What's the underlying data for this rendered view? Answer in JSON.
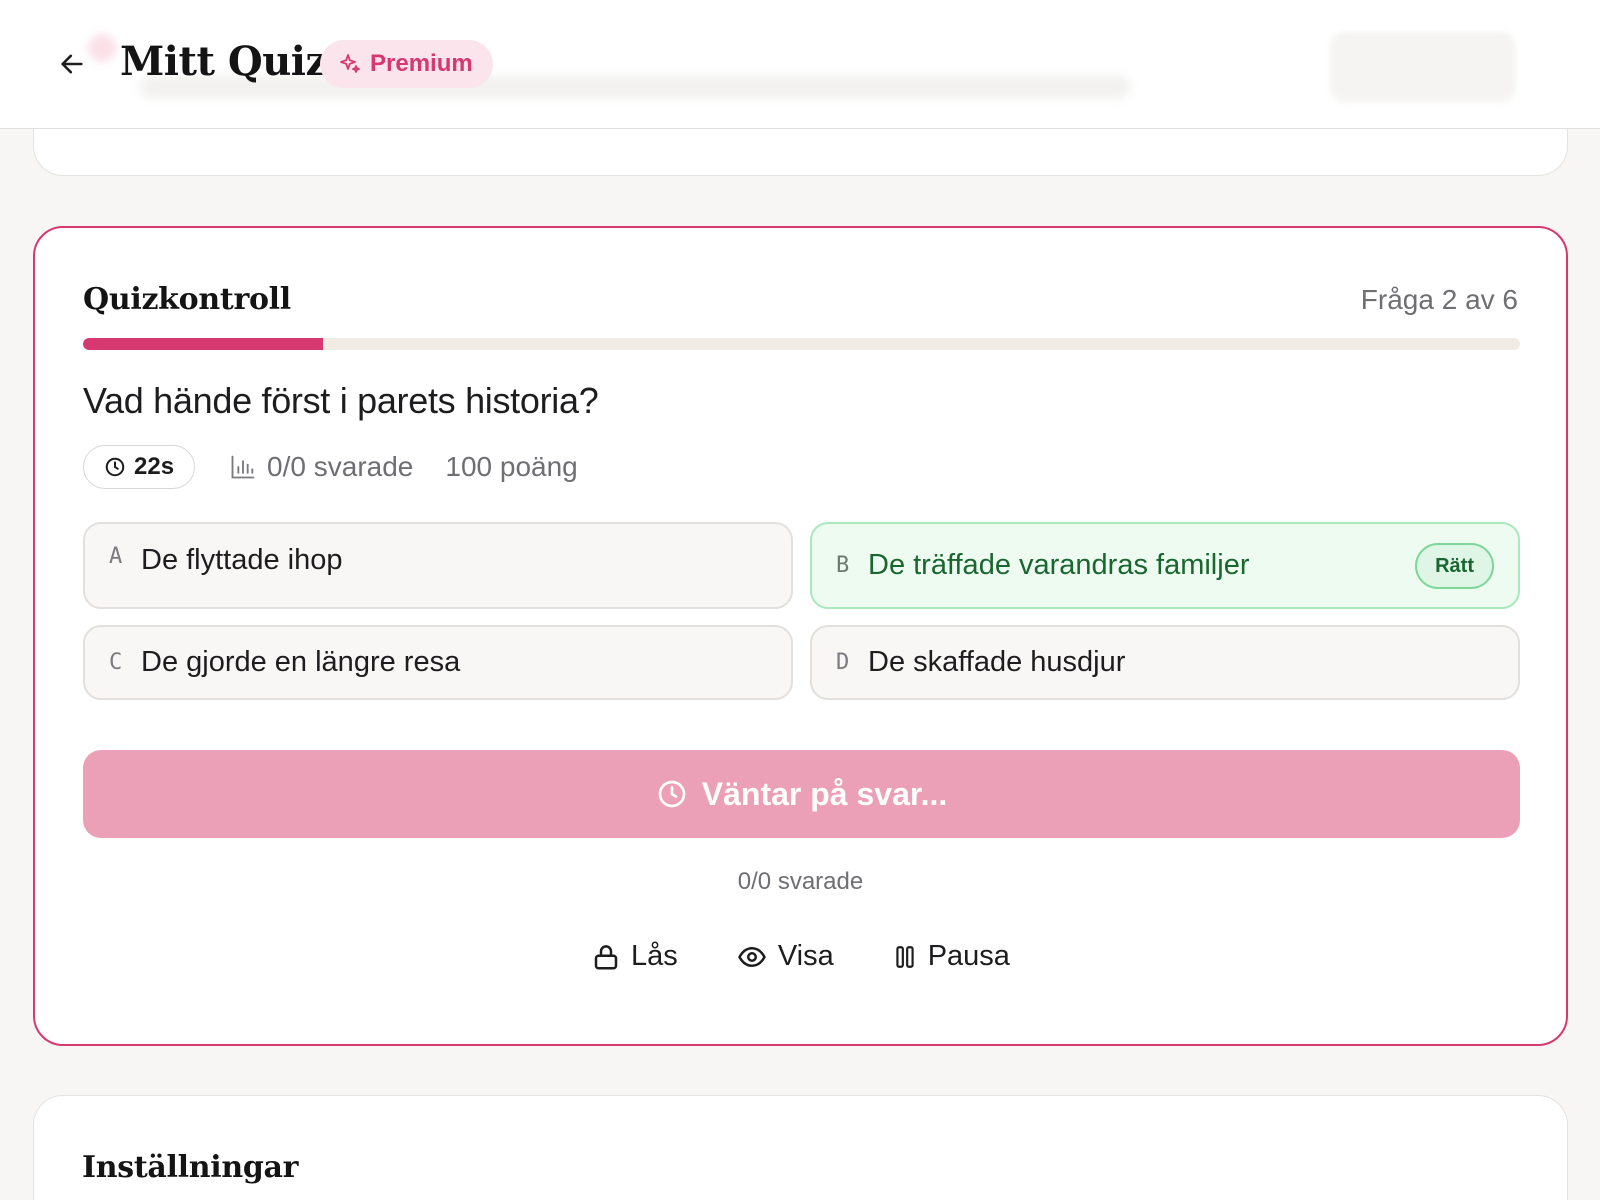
{
  "header": {
    "title": "Mitt Quiz",
    "badge": "Premium"
  },
  "quiz": {
    "title": "Quizkontroll",
    "progress_text": "Fråga 2 av 6",
    "progress_fraction": 0.1667,
    "question": "Vad hände först i parets historia?",
    "timer": "22s",
    "answered": "0/0 svarade",
    "points": "100 poäng",
    "options": [
      {
        "letter": "A",
        "text": "De flyttade ihop",
        "correct": false
      },
      {
        "letter": "B",
        "text": "De träffade varandras familjer",
        "correct": true,
        "badge": "Rätt"
      },
      {
        "letter": "C",
        "text": "De gjorde en längre resa",
        "correct": false
      },
      {
        "letter": "D",
        "text": "De skaffade husdjur",
        "correct": false
      }
    ],
    "wait_button": "Väntar på svar...",
    "answered_sub": "0/0 svarade",
    "controls": {
      "lock": "Lås",
      "show": "Visa",
      "pause": "Pausa"
    }
  },
  "settings": {
    "title": "Inställningar"
  },
  "colors": {
    "accent": "#d6386f",
    "correct": "#1a6630",
    "wait_button": "#eba0b8"
  }
}
